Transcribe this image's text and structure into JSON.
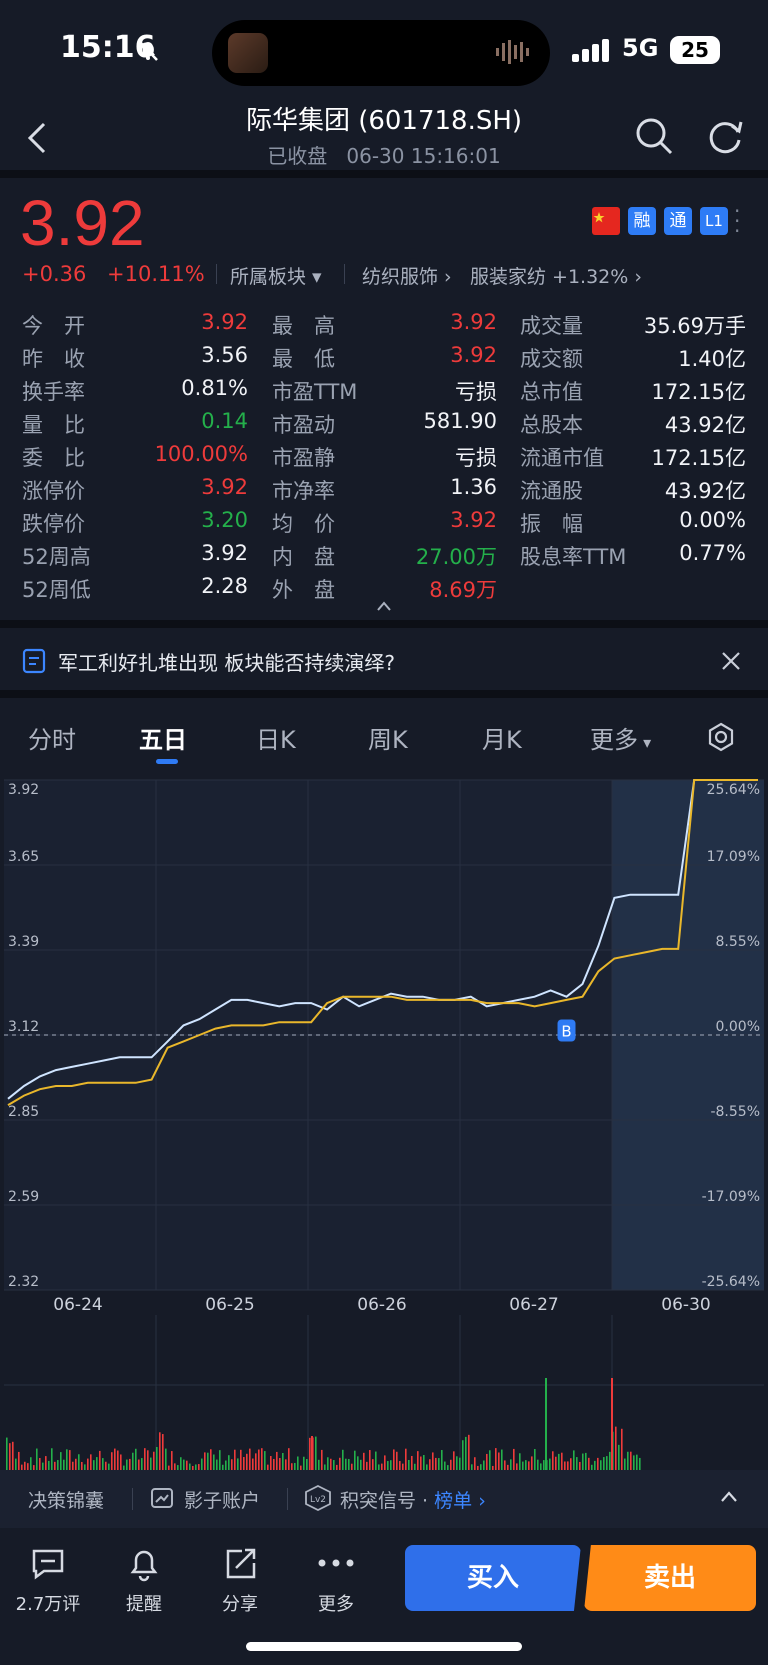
{
  "status": {
    "time": "15:16",
    "network": "5G",
    "battery": "25"
  },
  "header": {
    "title": "际华集团 (601718.SH)",
    "status": "已收盘",
    "datetime": "06-30 15:16:01"
  },
  "quote": {
    "price": "3.92",
    "change": "+0.36",
    "change_pct": "+10.11%",
    "sector_label": "所属板块",
    "sector_1": "纺织服饰",
    "sector_2": "服装家纺 +1.32%",
    "badges": [
      "融",
      "通",
      "L1"
    ]
  },
  "stats": [
    [
      {
        "label": "今　开",
        "value": "3.92",
        "color": "red"
      },
      {
        "label": "最　高",
        "value": "3.92",
        "color": "red"
      },
      {
        "label": "成交量",
        "value": "35.69万手",
        "color": "white"
      }
    ],
    [
      {
        "label": "昨　收",
        "value": "3.56",
        "color": "white"
      },
      {
        "label": "最　低",
        "value": "3.92",
        "color": "red"
      },
      {
        "label": "成交额",
        "value": "1.40亿",
        "color": "white"
      }
    ],
    [
      {
        "label": "换手率",
        "value": "0.81%",
        "color": "white"
      },
      {
        "label": "市盈TTM",
        "value": "亏损",
        "color": "white"
      },
      {
        "label": "总市值",
        "value": "172.15亿",
        "color": "white"
      }
    ],
    [
      {
        "label": "量　比",
        "value": "0.14",
        "color": "green"
      },
      {
        "label": "市盈动",
        "value": "581.90",
        "color": "white"
      },
      {
        "label": "总股本",
        "value": "43.92亿",
        "color": "white"
      }
    ],
    [
      {
        "label": "委　比",
        "value": "100.00%",
        "color": "red"
      },
      {
        "label": "市盈静",
        "value": "亏损",
        "color": "white"
      },
      {
        "label": "流通市值",
        "value": "172.15亿",
        "color": "white"
      }
    ],
    [
      {
        "label": "涨停价",
        "value": "3.92",
        "color": "red"
      },
      {
        "label": "市净率",
        "value": "1.36",
        "color": "white"
      },
      {
        "label": "流通股",
        "value": "43.92亿",
        "color": "white"
      }
    ],
    [
      {
        "label": "跌停价",
        "value": "3.20",
        "color": "green"
      },
      {
        "label": "均　价",
        "value": "3.92",
        "color": "red"
      },
      {
        "label": "振　幅",
        "value": "0.00%",
        "color": "white"
      }
    ],
    [
      {
        "label": "52周高",
        "value": "3.92",
        "color": "white"
      },
      {
        "label": "内　盘",
        "value": "27.00万",
        "color": "green"
      },
      {
        "label": "股息率TTM",
        "value": "0.77%",
        "color": "white"
      }
    ],
    [
      {
        "label": "52周低",
        "value": "2.28",
        "color": "white"
      },
      {
        "label": "外　盘",
        "value": "8.69万",
        "color": "red"
      },
      {
        "label": "",
        "value": "",
        "color": "white"
      }
    ]
  ],
  "news": {
    "text": "军工利好扎堆出现 板块能否持续演绎?"
  },
  "tabs": [
    "分时",
    "五日",
    "日K",
    "周K",
    "月K",
    "更多"
  ],
  "active_tab": "五日",
  "chart_data": {
    "type": "line",
    "x_labels": [
      "06-24",
      "06-25",
      "06-26",
      "06-27",
      "06-30"
    ],
    "y_left": [
      "3.92",
      "3.65",
      "3.39",
      "3.12",
      "2.85",
      "2.59",
      "2.32"
    ],
    "y_right": [
      "25.64%",
      "17.09%",
      "8.55%",
      "0.00%",
      "-8.55%",
      "-17.09%",
      "-25.64%"
    ],
    "ylim": [
      2.32,
      3.92
    ],
    "reference": 3.12,
    "marker": "B",
    "series": [
      {
        "values": [
          2.92,
          2.96,
          2.99,
          3.01,
          3.02,
          3.03,
          3.04,
          3.05,
          3.05,
          3.05,
          3.1,
          3.15,
          3.17,
          3.2,
          3.23,
          3.23,
          3.22,
          3.21,
          3.22,
          3.22,
          3.2,
          3.24,
          3.21,
          3.23,
          3.25,
          3.24,
          3.24,
          3.23,
          3.23,
          3.24,
          3.21,
          3.22,
          3.23,
          3.24,
          3.26,
          3.24,
          3.28,
          3.4,
          3.55,
          3.56,
          3.56,
          3.56,
          3.56,
          3.92,
          3.92,
          3.92,
          3.92,
          3.92
        ]
      },
      {
        "values": [
          2.9,
          2.93,
          2.95,
          2.96,
          2.96,
          2.97,
          2.97,
          2.97,
          2.97,
          2.98,
          3.08,
          3.1,
          3.12,
          3.14,
          3.15,
          3.15,
          3.15,
          3.16,
          3.16,
          3.16,
          3.22,
          3.24,
          3.24,
          3.24,
          3.24,
          3.23,
          3.23,
          3.23,
          3.23,
          3.23,
          3.22,
          3.22,
          3.22,
          3.21,
          3.22,
          3.23,
          3.24,
          3.32,
          3.36,
          3.37,
          3.38,
          3.39,
          3.39,
          3.92,
          3.92,
          3.92,
          3.92,
          3.92
        ]
      }
    ]
  },
  "toolbar": {
    "item1": "决策锦囊",
    "item2": "影子账户",
    "item3": "积突信号",
    "item3_link": "榜单"
  },
  "nav": {
    "comments": "2.7万评",
    "alert": "提醒",
    "share": "分享",
    "more": "更多",
    "buy": "买入",
    "sell": "卖出"
  }
}
